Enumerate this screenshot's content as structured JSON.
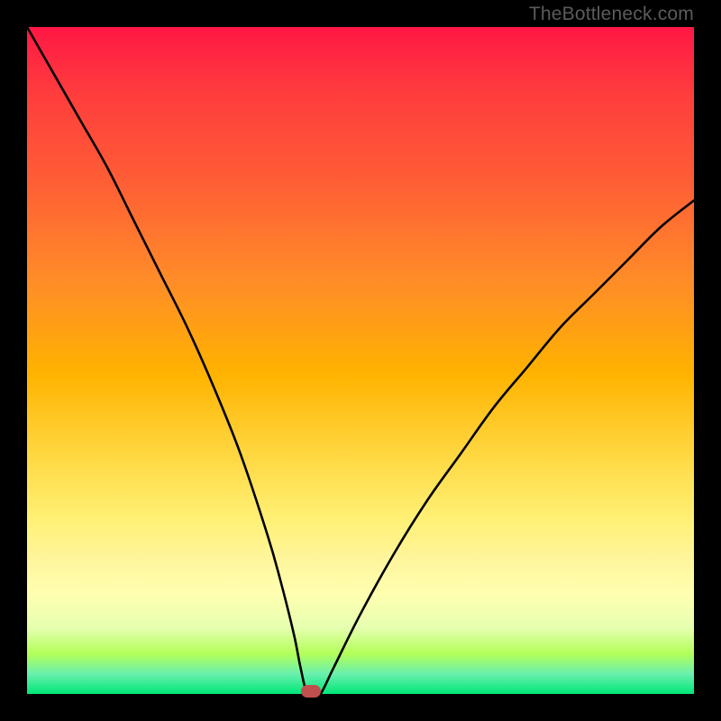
{
  "watermark": "TheBottleneck.com",
  "marker_color": "#c0504d",
  "chart_data": {
    "type": "line",
    "title": "",
    "xlabel": "",
    "ylabel": "",
    "xlim": [
      0,
      100
    ],
    "ylim": [
      0,
      100
    ],
    "x": [
      0,
      4,
      8,
      12,
      16,
      20,
      24,
      28,
      32,
      36,
      38,
      40,
      41,
      42,
      43,
      44,
      46,
      50,
      55,
      60,
      65,
      70,
      75,
      80,
      85,
      90,
      95,
      100
    ],
    "values": [
      100,
      93,
      86,
      79,
      71,
      63,
      55,
      46,
      36,
      24,
      17,
      9,
      4,
      0,
      0,
      0,
      4,
      12,
      21,
      29,
      36,
      43,
      49,
      55,
      60,
      65,
      70,
      74
    ],
    "marker": {
      "x": 42.5,
      "y": 0
    }
  }
}
